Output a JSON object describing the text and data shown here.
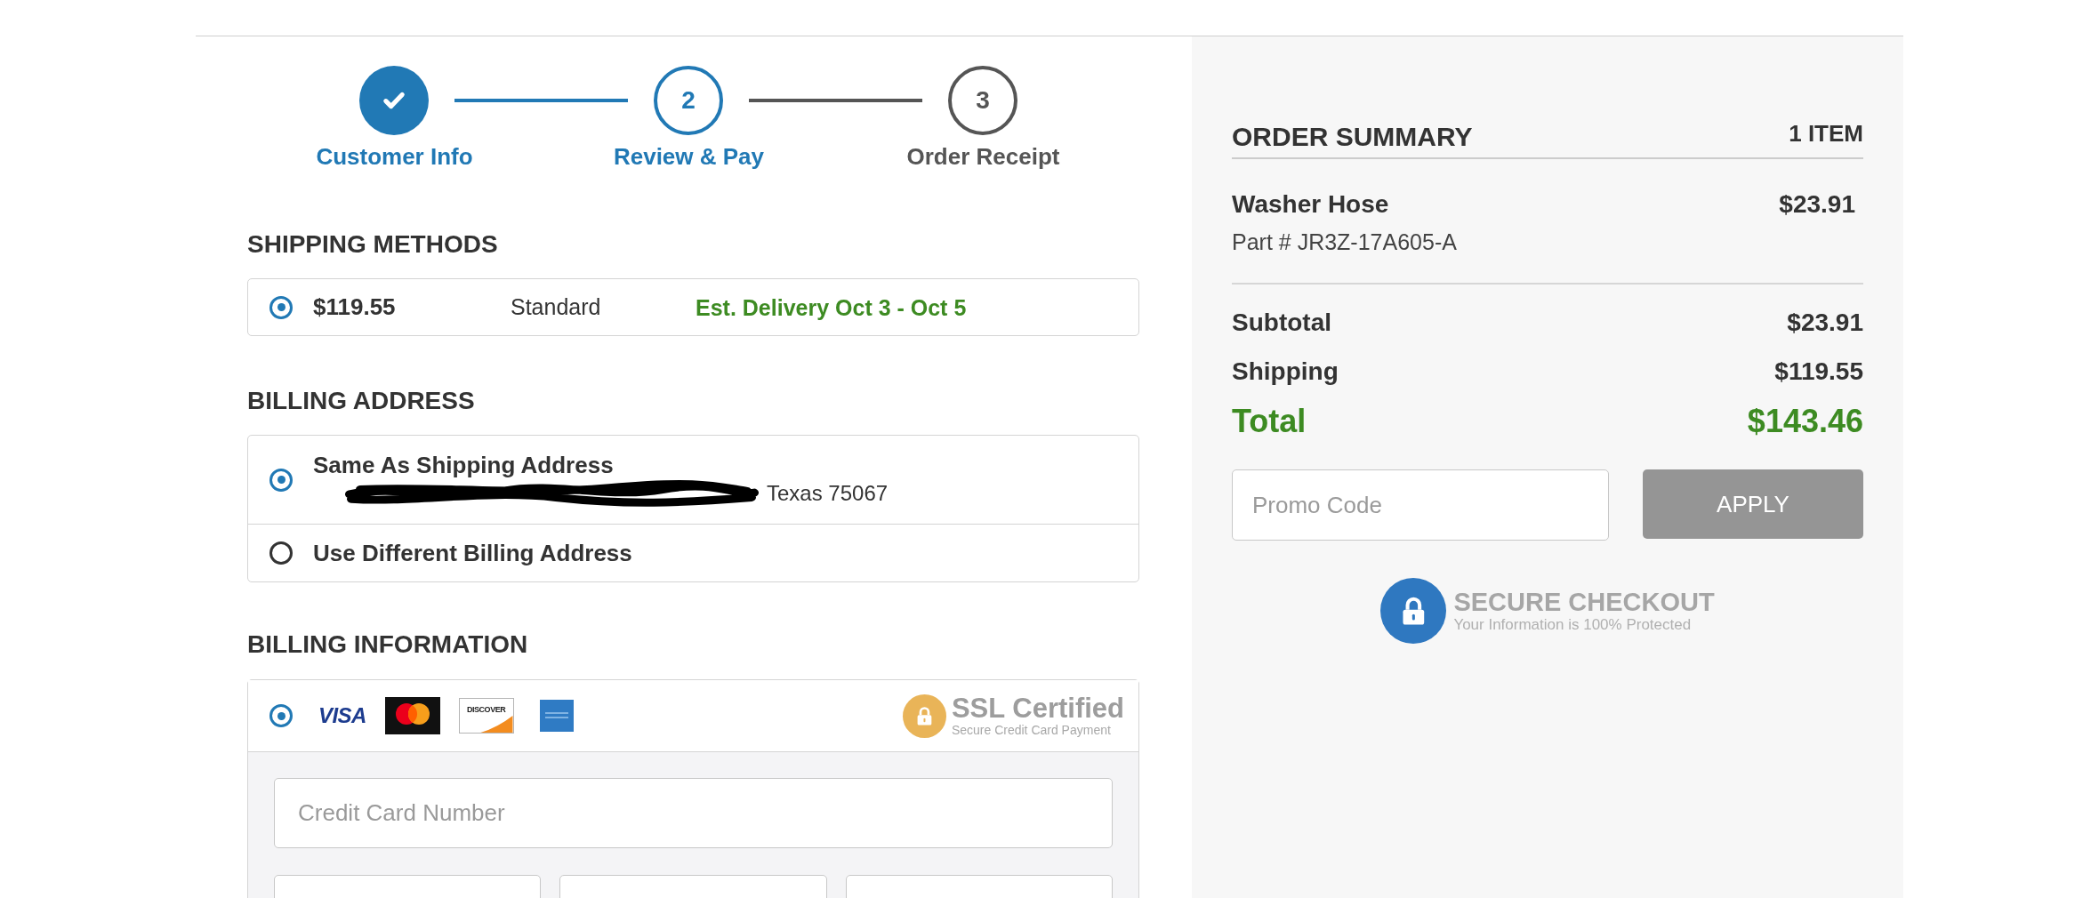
{
  "steps": [
    {
      "label": "Customer Info",
      "completed": true,
      "selected": false
    },
    {
      "number": "2",
      "label": "Review & Pay",
      "completed": false,
      "selected": true
    },
    {
      "number": "3",
      "label": "Order Receipt",
      "completed": false,
      "selected": false
    }
  ],
  "shipping_methods": {
    "title": "SHIPPING METHODS",
    "options": [
      {
        "price": "$119.55",
        "name": "Standard",
        "delivery": "Est. Delivery Oct 3 - Oct 5",
        "selected": true
      }
    ]
  },
  "billing_address": {
    "title": "BILLING ADDRESS",
    "options": [
      {
        "label": "Same As Shipping Address",
        "address": "Texas 75067",
        "redacted": true,
        "selected": true
      },
      {
        "label": "Use Different Billing Address",
        "selected": false
      }
    ]
  },
  "billing_information": {
    "title": "BILLING INFORMATION",
    "selected": true,
    "cards": [
      {
        "kind": "visa",
        "text": "VISA"
      },
      {
        "kind": "mastercard"
      },
      {
        "kind": "discover",
        "text": "DISCOVER"
      },
      {
        "kind": "amex"
      }
    ],
    "ssl_badge": {
      "title": "SSL Certified",
      "subtitle": "Secure Credit Card Payment"
    },
    "fields": [
      {
        "kind": "wide",
        "placeholder": "Credit Card Number"
      },
      {
        "kind": "narrow"
      },
      {
        "kind": "narrow"
      },
      {
        "kind": "narrow"
      }
    ]
  },
  "order_summary": {
    "title": "ORDER SUMMARY",
    "count": "1 ITEM",
    "items": [
      {
        "name": "Washer Hose",
        "part": "Part # JR3Z-17A605-A",
        "price": "$23.91"
      }
    ],
    "lines": [
      {
        "kind": "normal",
        "label": "Subtotal",
        "value": "$23.91"
      },
      {
        "kind": "normal",
        "label": "Shipping",
        "value": "$119.55"
      },
      {
        "kind": "total",
        "label": "Total",
        "value": "$143.46"
      }
    ],
    "promo": {
      "placeholder": "Promo Code"
    },
    "apply_button": "APPLY",
    "secure": {
      "title": "SECURE CHECKOUT",
      "subtitle": "Your Information is 100% Protected"
    }
  }
}
